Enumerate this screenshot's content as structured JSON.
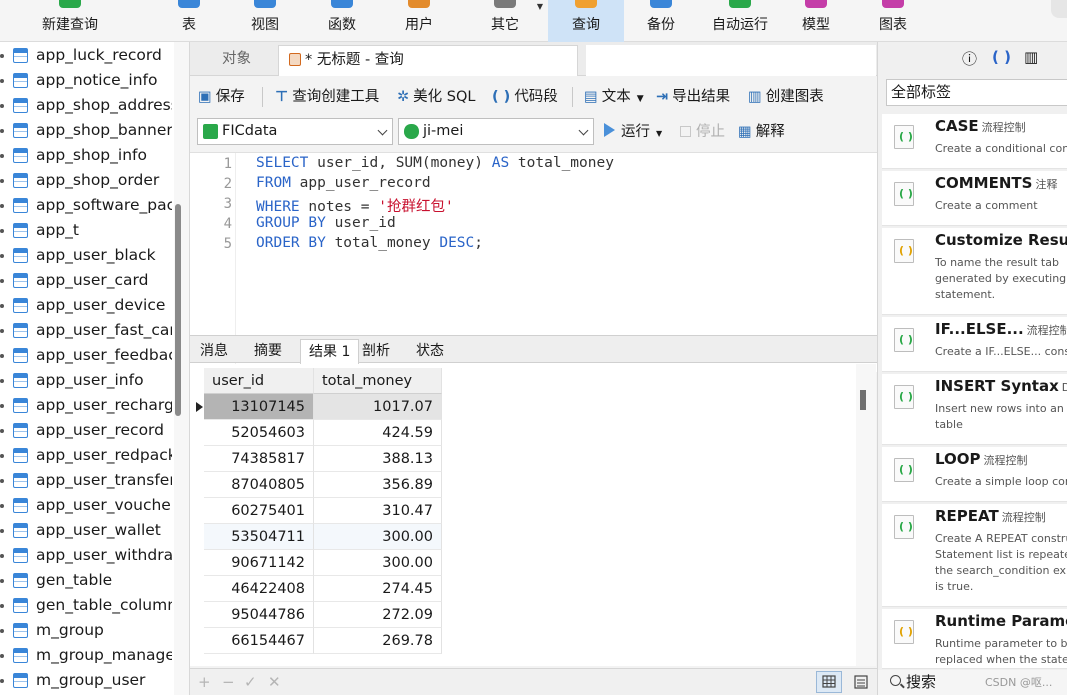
{
  "ribbon": {
    "items": [
      {
        "label": "新建查询",
        "icon": "new-query-icon",
        "color": "#2aa84a"
      },
      {
        "label": "表",
        "icon": "table-icon",
        "color": "#3a86d8"
      },
      {
        "label": "视图",
        "icon": "view-icon",
        "color": "#3a86d8"
      },
      {
        "label": "函数",
        "icon": "function-icon",
        "color": "#3a86d8"
      },
      {
        "label": "用户",
        "icon": "user-icon",
        "color": "#e38b2c"
      },
      {
        "label": "其它",
        "icon": "other-icon",
        "color": "#7a7a7a"
      },
      {
        "label": "查询",
        "icon": "query-icon",
        "color": "#f0a030"
      },
      {
        "label": "备份",
        "icon": "backup-icon",
        "color": "#3a86d8"
      },
      {
        "label": "自动运行",
        "icon": "auto-run-icon",
        "color": "#2aa84a"
      },
      {
        "label": "模型",
        "icon": "model-icon",
        "color": "#c43da8"
      },
      {
        "label": "图表",
        "icon": "chart-icon",
        "color": "#c43da8"
      }
    ],
    "active": "查询"
  },
  "sidebar": {
    "tables": [
      "app_luck_record",
      "app_notice_info",
      "app_shop_address",
      "app_shop_banner",
      "app_shop_info",
      "app_shop_order",
      "app_software_pac",
      "app_t",
      "app_user_black",
      "app_user_card",
      "app_user_device",
      "app_user_fast_card",
      "app_user_feedbac",
      "app_user_info",
      "app_user_recharge",
      "app_user_record",
      "app_user_redpack",
      "app_user_transfer",
      "app_user_voucher",
      "app_user_wallet",
      "app_user_withdraw",
      "gen_table",
      "gen_table_column",
      "m_group",
      "m_group_manage",
      "m_group_user"
    ]
  },
  "tabs": {
    "objects": "对象",
    "query": "* 无标题 - 查询"
  },
  "toolbar1": {
    "save": "保存",
    "builder": "查询创建工具",
    "beautify": "美化 SQL",
    "snippet": "代码段",
    "text": "文本",
    "export": "导出结果",
    "create_chart": "创建图表"
  },
  "toolbar2": {
    "connection": "FICdata",
    "database": "ji-mei",
    "run": "运行",
    "stop": "停止",
    "explain": "解释"
  },
  "editor": {
    "lines": [
      [
        {
          "t": "SELECT",
          "k": 1
        },
        {
          "t": " user_id, SUM(money) ",
          "k": 0
        },
        {
          "t": "AS",
          "k": 1
        },
        {
          "t": " total_money",
          "k": 0
        }
      ],
      [
        {
          "t": "FROM",
          "k": 1
        },
        {
          "t": " app_user_record",
          "k": 0
        }
      ],
      [
        {
          "t": "WHERE",
          "k": 1
        },
        {
          "t": " notes = ",
          "k": 0
        },
        {
          "t": "'抢群红包'",
          "k": 2
        }
      ],
      [
        {
          "t": "GROUP BY",
          "k": 1
        },
        {
          "t": " user_id",
          "k": 0
        }
      ],
      [
        {
          "t": "ORDER BY",
          "k": 1
        },
        {
          "t": " total_money ",
          "k": 0
        },
        {
          "t": "DESC",
          "k": 1
        },
        {
          "t": ";",
          "k": 0
        }
      ]
    ]
  },
  "result_tabs": [
    "消息",
    "摘要",
    "结果 1",
    "剖析",
    "状态"
  ],
  "result_active": "结果 1",
  "grid": {
    "columns": [
      "user_id",
      "total_money"
    ],
    "rows": [
      [
        "13107145",
        "1017.07"
      ],
      [
        "52054603",
        "424.59"
      ],
      [
        "74385817",
        "388.13"
      ],
      [
        "87040805",
        "356.89"
      ],
      [
        "60275401",
        "310.47"
      ],
      [
        "53504711",
        "300.00"
      ],
      [
        "90671142",
        "300.00"
      ],
      [
        "46422408",
        "274.45"
      ],
      [
        "95044786",
        "272.09"
      ],
      [
        "66154467",
        "269.78"
      ]
    ]
  },
  "statusbar": {
    "buttons": [
      "+",
      "−",
      "✓",
      "✕"
    ]
  },
  "rpanel": {
    "filter": "全部标签",
    "snippets": [
      {
        "title": "CASE",
        "tag": "流程控制",
        "desc": "Create a conditional cons",
        "icon": "green"
      },
      {
        "title": "COMMENTS",
        "tag": "注释",
        "desc": "Create a comment",
        "icon": "green"
      },
      {
        "title": "Customize Result",
        "tag": "",
        "desc": "To name the result tab\ngenerated by executing th\nstatement.",
        "icon": "yellow"
      },
      {
        "title": "IF...ELSE...",
        "tag": "流程控制",
        "desc": "Create a IF...ELSE... constr",
        "icon": "green"
      },
      {
        "title": "INSERT Syntax",
        "tag": "DM",
        "desc": "Insert new rows into an ex\ntable",
        "icon": "green"
      },
      {
        "title": "LOOP",
        "tag": "流程控制",
        "desc": "Create a simple loop cons",
        "icon": "green"
      },
      {
        "title": "REPEAT",
        "tag": "流程控制",
        "desc": "Create A REPEAT construc\nStatement list is repeated\nthe search_condition exp\nis true.",
        "icon": "green"
      },
      {
        "title": "Runtime Paramet",
        "tag": "",
        "desc": "Runtime parameter to be\nreplaced when the statem",
        "icon": "yellow"
      }
    ],
    "search": "搜索",
    "watermark": "CSDN @呕..."
  }
}
